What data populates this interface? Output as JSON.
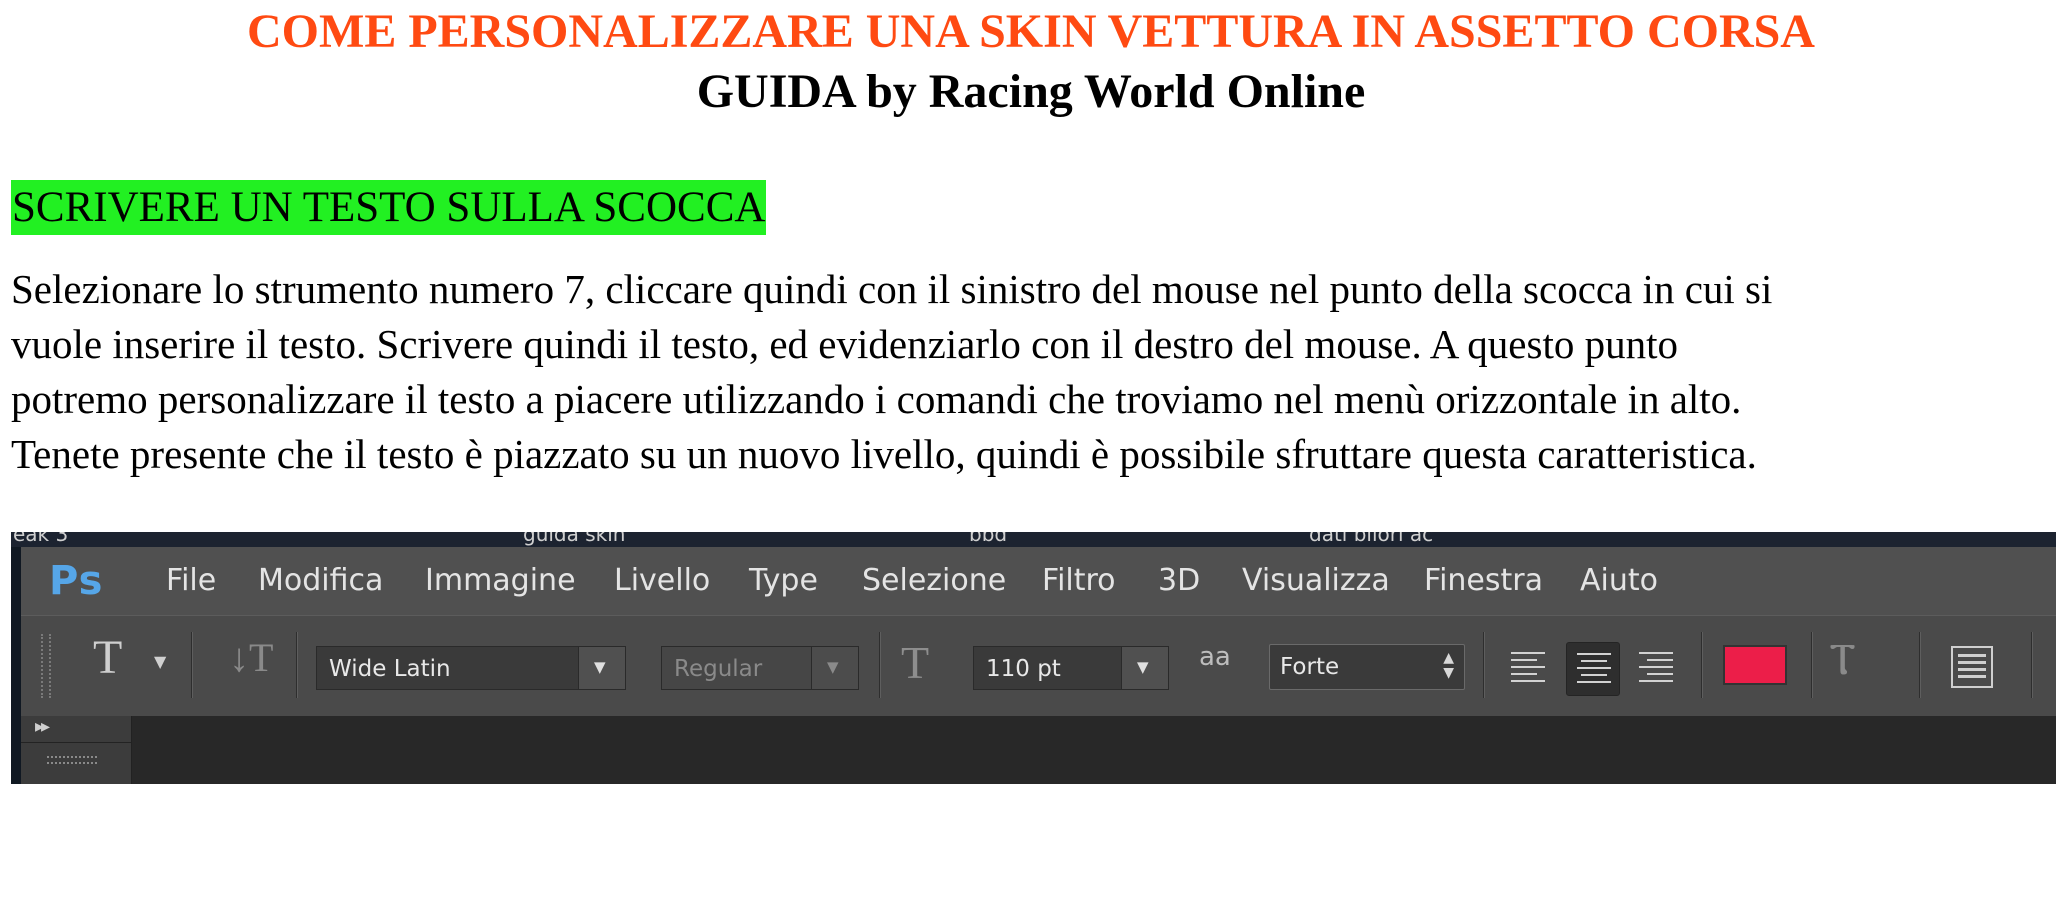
{
  "document": {
    "title": "COME PERSONALIZZARE UNA SKIN VETTURA IN ASSETTO CORSA",
    "subtitle": "GUIDA by Racing World Online",
    "section_heading": "SCRIVERE UN TESTO SULLA SCOCCA",
    "body_lines": [
      "Selezionare lo strumento numero 7, cliccare quindi con il sinistro del mouse nel punto della scocca in cui si",
      "vuole inserire il testo. Scrivere quindi il testo, ed evidenziarlo con il destro del mouse. A questo punto",
      "potremo personalizzare il testo a piacere utilizzando i comandi che troviamo nel menù orizzontale in alto.",
      "Tenete presente che il testo è piazzato su un nuovo livello, quindi è possibile sfruttare questa caratteristica."
    ],
    "title_color": "#ff4a12",
    "highlight_color": "#22f022"
  },
  "screenshot": {
    "taskbar_labels": [
      "eak 3",
      "guida skin",
      "bbd",
      "dati bilori ac"
    ],
    "logo": "Ps",
    "menu": [
      "File",
      "Modifica",
      "Immagine",
      "Livello",
      "Type",
      "Selezione",
      "Filtro",
      "3D",
      "Visualizza",
      "Finestra",
      "Aiuto"
    ],
    "options_bar": {
      "tool_icon": "T",
      "font_family": "Wide Latin",
      "font_style": "Regular",
      "font_size": "110 pt",
      "antialias_icon": "aa",
      "antialias": "Forte",
      "text_color": "#ec1e49",
      "active_alignment": "center"
    }
  }
}
